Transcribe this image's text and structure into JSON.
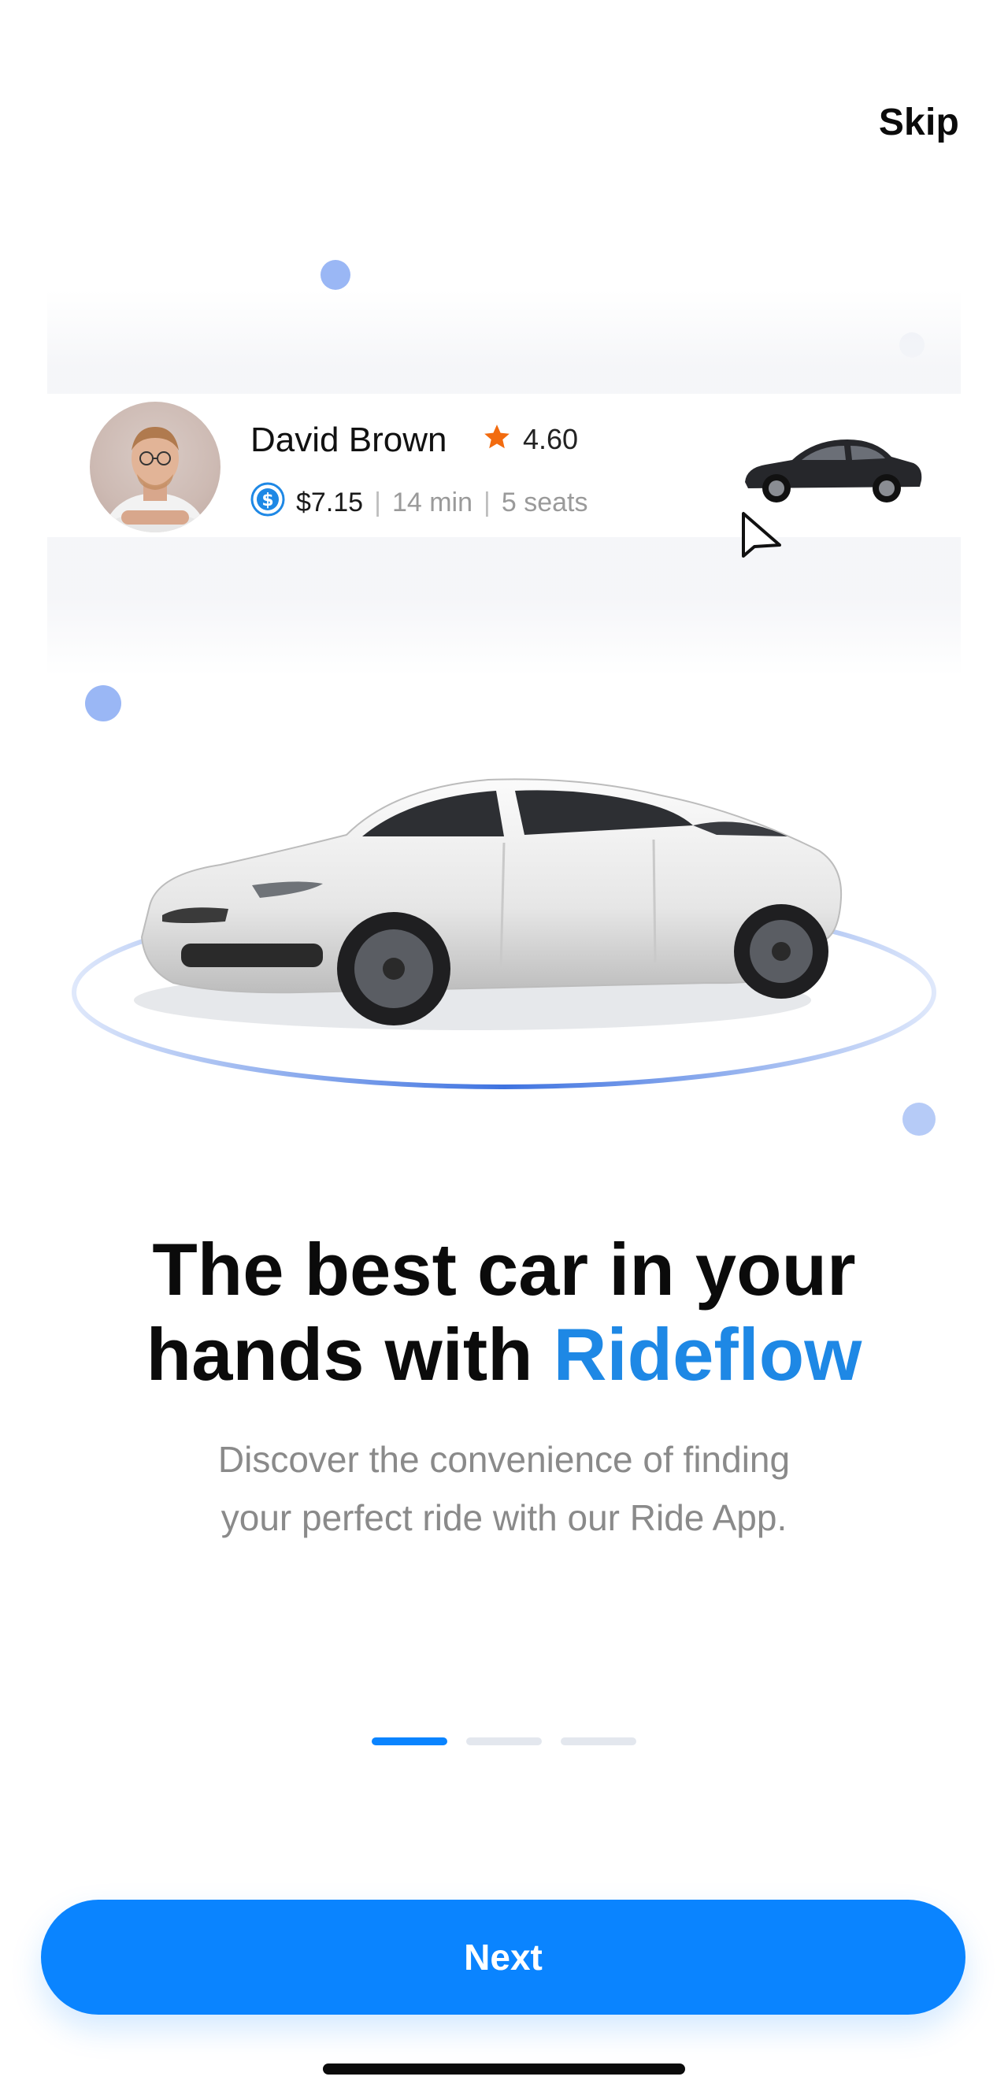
{
  "header": {
    "skip_label": "Skip"
  },
  "driver_card": {
    "name": "David Brown",
    "rating": "4.60",
    "price": "$7.15",
    "duration": "14 min",
    "seats": "5 seats",
    "separator": "|"
  },
  "onboarding": {
    "headline_part1": "The best car in your",
    "headline_part2": "hands with ",
    "headline_brand": "Rideflow",
    "subtitle_line1": "Discover the convenience of finding",
    "subtitle_line2": "your perfect ride with our Ride App.",
    "pages_total": 3,
    "current_page": 1
  },
  "footer": {
    "next_label": "Next"
  },
  "colors": {
    "accent": "#0a84ff",
    "brand_text": "#1e88e5",
    "star": "#f26b0f",
    "dots": "#9ab7f5",
    "inactive_pager": "#e3e7ee"
  }
}
